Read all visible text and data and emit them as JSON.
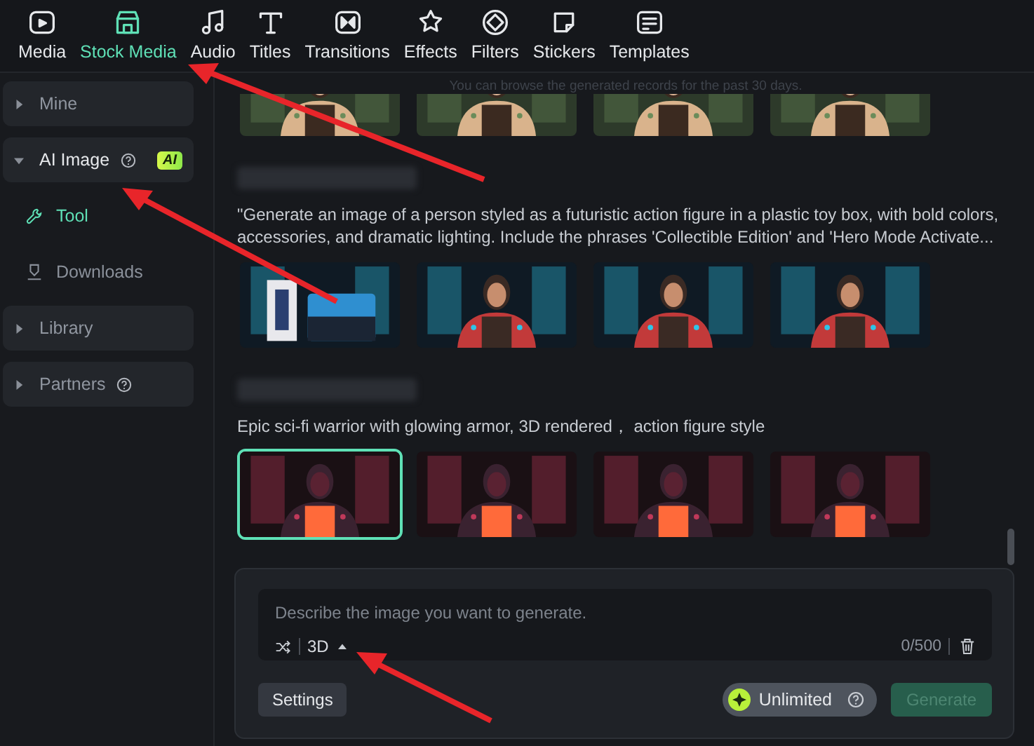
{
  "toolbar": {
    "tabs": [
      {
        "label": "Media",
        "selected": false
      },
      {
        "label": "Stock Media",
        "selected": true
      },
      {
        "label": "Audio",
        "selected": false
      },
      {
        "label": "Titles",
        "selected": false
      },
      {
        "label": "Transitions",
        "selected": false
      },
      {
        "label": "Effects",
        "selected": false
      },
      {
        "label": "Filters",
        "selected": false
      },
      {
        "label": "Stickers",
        "selected": false
      },
      {
        "label": "Templates",
        "selected": false
      }
    ]
  },
  "sidebar": {
    "items": [
      {
        "kind": "section",
        "label": "Mine",
        "expanded": false,
        "help": false
      },
      {
        "kind": "section",
        "label": "AI Image",
        "expanded": true,
        "help": true,
        "badge": "AI"
      },
      {
        "kind": "subitem",
        "label": "Tool",
        "selected": true
      },
      {
        "kind": "subitem",
        "label": "Downloads",
        "selected": false
      },
      {
        "kind": "section",
        "label": "Library",
        "expanded": false,
        "help": false
      },
      {
        "kind": "section",
        "label": "Partners",
        "expanded": false,
        "help": true
      }
    ]
  },
  "content": {
    "notice": "You can browse the generated records for the past 30 days.",
    "groups": [
      {
        "blurred_header": false,
        "images": [
          {
            "selected": false
          },
          {
            "selected": false
          },
          {
            "selected": false
          },
          {
            "selected": false
          }
        ]
      },
      {
        "blurred_header": true,
        "prompt": "\"Generate an image of a person styled as a futuristic action figure in a plastic toy box, with bold colors, accessories, and dramatic lighting. Include the phrases 'Collectible Edition' and 'Hero Mode Activate...",
        "images": [
          {
            "selected": false
          },
          {
            "selected": false
          },
          {
            "selected": false
          },
          {
            "selected": false
          }
        ]
      },
      {
        "blurred_header": true,
        "prompt": "Epic sci-fi warrior with glowing armor, 3D rendered，  action figure style",
        "images": [
          {
            "selected": true
          },
          {
            "selected": false
          },
          {
            "selected": false
          },
          {
            "selected": false
          }
        ]
      }
    ]
  },
  "composer": {
    "placeholder": "Describe the image you want to generate.",
    "style": "3D",
    "counter": "0/500",
    "settings": "Settings",
    "credits": "Unlimited",
    "generate": {
      "label": "Generate",
      "disabled": true
    }
  }
}
